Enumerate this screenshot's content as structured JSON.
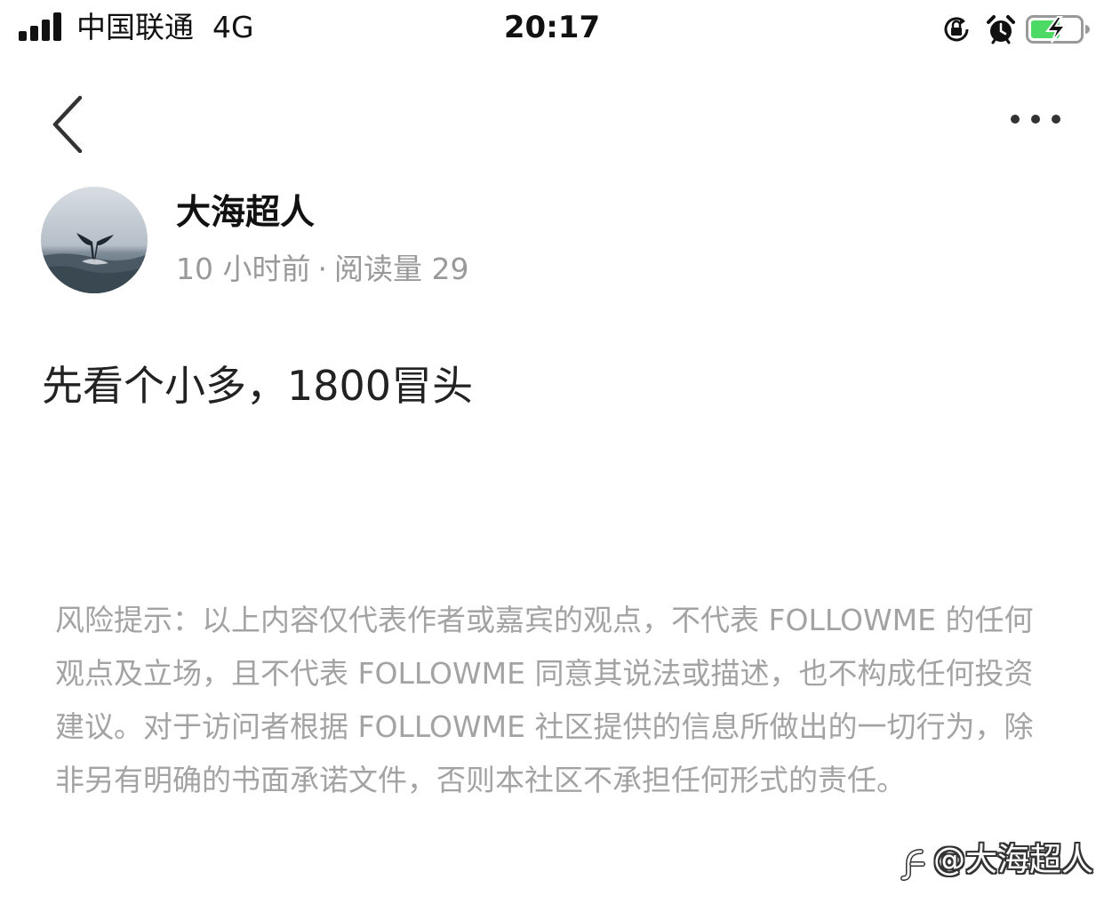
{
  "status_bar": {
    "carrier": "中国联通",
    "network": "4G",
    "time": "20:17",
    "icons": [
      "rotation-lock-icon",
      "alarm-icon",
      "battery-charging-icon"
    ],
    "battery_color": "#4cd964"
  },
  "nav": {
    "back_icon": "chevron-left-icon",
    "more_icon": "more-horizontal-icon"
  },
  "author": {
    "name": "大海超人",
    "time_ago": "10 小时前",
    "separator": "·",
    "read_count_label": "阅读量 29"
  },
  "post": {
    "content": "先看个小多，1800冒头"
  },
  "disclaimer": {
    "text": "风险提示：以上内容仅代表作者或嘉宾的观点，不代表 FOLLOWME 的任何观点及立场，且不代表 FOLLOWME 同意其说法或描述，也不构成任何投资建议。对于访问者根据 FOLLOWME 社区提供的信息所做出的一切行为，除非另有明确的书面承诺文件，否则本社区不承担任何形式的责任。"
  },
  "watermark": {
    "text": "@大海超人"
  }
}
